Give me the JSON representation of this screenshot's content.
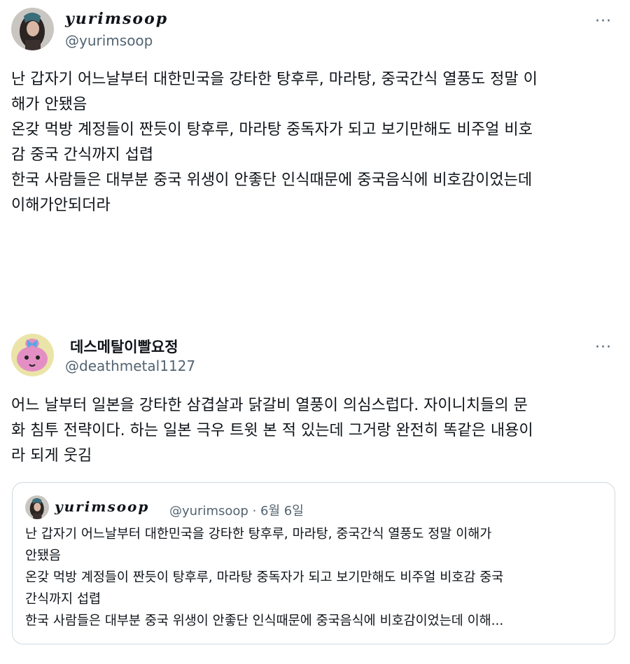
{
  "tweets": [
    {
      "display_name": "yurimsoop",
      "handle": "@yurimsoop",
      "more_label": "···",
      "lines": [
        "난 갑자기 어느날부터 대한민국을 강타한 탕후루, 마라탕, 중국간식 열풍도 정말 이",
        "해가 안됐음",
        "온갖 먹방 계정들이 짠듯이 탕후루, 마라탕 중독자가 되고 보기만해도 비주얼 비호",
        "감 중국 간식까지 섭렵",
        "한국 사람들은 대부분 중국 위생이 안좋단 인식때문에 중국음식에 비호감이었는데",
        "이해가안되더라"
      ]
    },
    {
      "display_name": "데스메탈이빨요정",
      "handle": "@deathmetal1127",
      "more_label": "···",
      "lines": [
        "어느 날부터 일본을 강타한 삼겹살과 닭갈비 열풍이 의심스럽다. 자이니치들의 문",
        "화 침투 전략이다. 하는 일본 극우 트윗 본 적 있는데 그거랑 완전히 똑같은 내용이",
        "라 되게 웃김"
      ],
      "quoted": {
        "display_name": "yurimsoop",
        "handle": "@yurimsoop",
        "separator": "·",
        "date": "6월 6일",
        "lines": [
          "난 갑자기 어느날부터 대한민국을 강타한 탕후루, 마라탕, 중국간식 열풍도 정말 이해가",
          "안됐음",
          "온갖 먹방 계정들이 짠듯이 탕후루, 마라탕 중독자가 되고 보기만해도 비주얼 비호감 중국",
          "간식까지 섭렵",
          "한국 사람들은 대부분 중국 위생이 안좋단 인식때문에 중국음식에 비호감이었는데 이해..."
        ]
      }
    }
  ],
  "colors": {
    "text": "#0f1419",
    "secondary": "#536471",
    "border": "#cfd9de"
  },
  "icons": [
    "avatar-girl-icon",
    "avatar-cartoon-icon",
    "more-options-icon"
  ]
}
